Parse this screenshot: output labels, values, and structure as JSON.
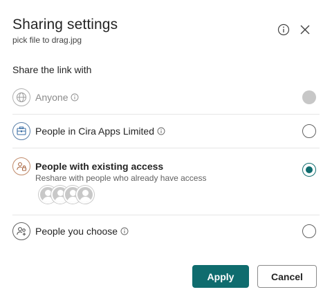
{
  "dialog": {
    "title": "Sharing settings",
    "subtitle": "pick file to drag.jpg",
    "info_icon": "info-icon",
    "close_icon": "close-icon"
  },
  "section": {
    "label": "Share the link with"
  },
  "options": [
    {
      "label": "Anyone",
      "icon": "globe-icon",
      "has_info": true,
      "state": "disabled"
    },
    {
      "label": "People in Cira Apps Limited",
      "icon": "building-icon",
      "has_info": true,
      "state": "unchecked"
    },
    {
      "label": "People with existing access",
      "description": "Reshare with people who already have access",
      "icon": "people-lock-icon",
      "has_info": false,
      "state": "checked",
      "avatar_count": 4
    },
    {
      "label": "People you choose",
      "icon": "people-add-icon",
      "has_info": true,
      "state": "unchecked"
    }
  ],
  "buttons": {
    "apply": "Apply",
    "cancel": "Cancel"
  },
  "colors": {
    "accent": "#0f6c6e",
    "disabled_radio": "#c7c7c7",
    "text": "#242424",
    "muted_text": "#616161"
  }
}
